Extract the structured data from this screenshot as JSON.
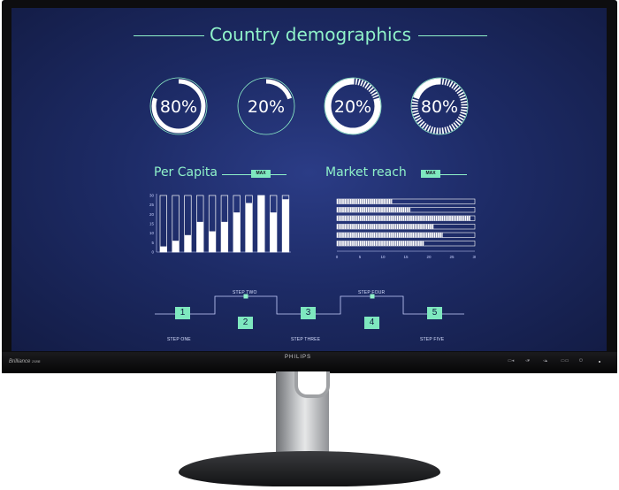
{
  "screen": {
    "title": "Country demographics",
    "rings": [
      {
        "label": "80%",
        "value": 0.8,
        "style": "solid"
      },
      {
        "label": "20%",
        "value": 0.2,
        "style": "solid"
      },
      {
        "label": "20%",
        "value": 0.2,
        "style": "dashed"
      },
      {
        "label": "80%",
        "value": 0.8,
        "style": "dashed"
      }
    ],
    "per_capita": {
      "title": "Per Capita",
      "badge": "MAX",
      "y_ticks": [
        "30",
        "25",
        "20",
        "15",
        "10",
        "5",
        "0"
      ],
      "values": [
        3,
        6,
        9,
        16,
        11,
        16,
        21,
        26,
        30,
        21,
        28
      ],
      "ylim": [
        0,
        30
      ]
    },
    "market_reach": {
      "title": "Market reach",
      "badge": "MAX",
      "x_ticks": [
        "0",
        "5",
        "10",
        "15",
        "20",
        "25",
        "30"
      ],
      "values": [
        12,
        16,
        29,
        21,
        23,
        19
      ],
      "xlim": [
        0,
        30
      ]
    },
    "steps": [
      {
        "number": "1",
        "label": "STEP ONE"
      },
      {
        "number": "2",
        "label": "STEP TWO"
      },
      {
        "number": "3",
        "label": "STEP THREE"
      },
      {
        "number": "4",
        "label": "STEP FOUR"
      },
      {
        "number": "5",
        "label": "STEP FIVE"
      }
    ]
  },
  "monitor": {
    "model": "Brilliance",
    "model_code": "258B",
    "brand": "PHILIPS"
  },
  "colors": {
    "accent": "#8ff2c9",
    "screen_bg": "#1d2b66"
  }
}
